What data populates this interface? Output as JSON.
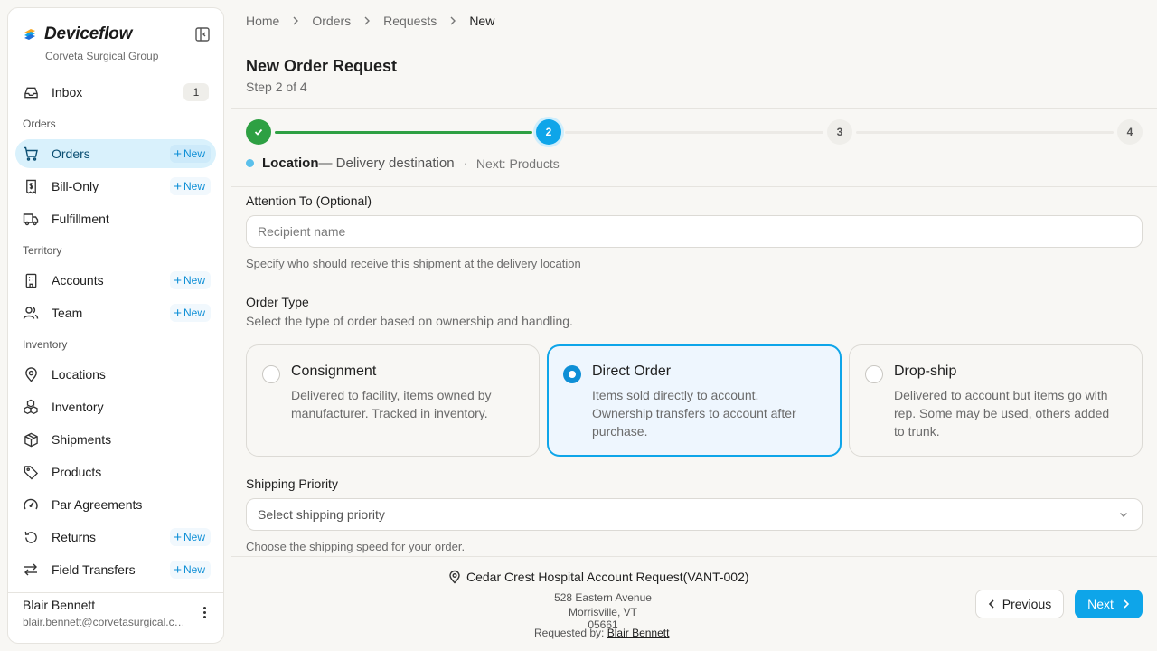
{
  "brand": {
    "name": "Deviceflow",
    "org": "Corveta Surgical Group"
  },
  "sidebar": {
    "inbox": {
      "label": "Inbox",
      "count": "1"
    },
    "sections": {
      "orders": "Orders",
      "territory": "Territory",
      "inventory": "Inventory"
    },
    "new_label": "New",
    "items": {
      "orders": "Orders",
      "bill_only": "Bill-Only",
      "fulfillment": "Fulfillment",
      "accounts": "Accounts",
      "team": "Team",
      "locations": "Locations",
      "inventory": "Inventory",
      "shipments": "Shipments",
      "products": "Products",
      "par_agreements": "Par Agreements",
      "returns": "Returns",
      "field_transfers": "Field Transfers"
    },
    "user": {
      "name": "Blair Bennett",
      "email": "blair.bennett@corvetasurgical.com"
    }
  },
  "breadcrumb": [
    "Home",
    "Orders",
    "Requests",
    "New"
  ],
  "page": {
    "title": "New Order Request",
    "subtitle": "Step 2 of 4"
  },
  "stepper": {
    "current": 2,
    "steps": [
      "1",
      "2",
      "3",
      "4"
    ],
    "caption_title": "Location",
    "caption_desc": "— Delivery destination",
    "caption_sep": "·",
    "caption_next": "Next: Products"
  },
  "form": {
    "attention": {
      "label": "Attention To (Optional)",
      "placeholder": "Recipient name",
      "value": "",
      "help": "Specify who should receive this shipment at the delivery location"
    },
    "order_type": {
      "label": "Order Type",
      "help": "Select the type of order based on ownership and handling.",
      "selected": "Direct Order",
      "options": [
        {
          "title": "Consignment",
          "desc": "Delivered to facility, items owned by manufacturer. Tracked in inventory."
        },
        {
          "title": "Direct Order",
          "desc": "Items sold directly to account. Ownership transfers to account after purchase."
        },
        {
          "title": "Drop-ship",
          "desc": "Delivered to account but items go with rep. Some may be used, others added to trunk."
        }
      ]
    },
    "shipping_priority": {
      "label": "Shipping Priority",
      "placeholder": "Select shipping priority",
      "help": "Choose the shipping speed for your order."
    }
  },
  "footer": {
    "account": "Cedar Crest Hospital Account Request(VANT-002)",
    "address_line1": "528 Eastern Avenue",
    "address_line2": "Morrisville, VT 05661",
    "requested_by_label": "Requested by:",
    "requested_by": "Blair Bennett",
    "prev": "Previous",
    "next": "Next"
  },
  "colors": {
    "accent": "#0ea5e9",
    "success": "#2ea043",
    "active_nav": "#d9f1fc"
  }
}
